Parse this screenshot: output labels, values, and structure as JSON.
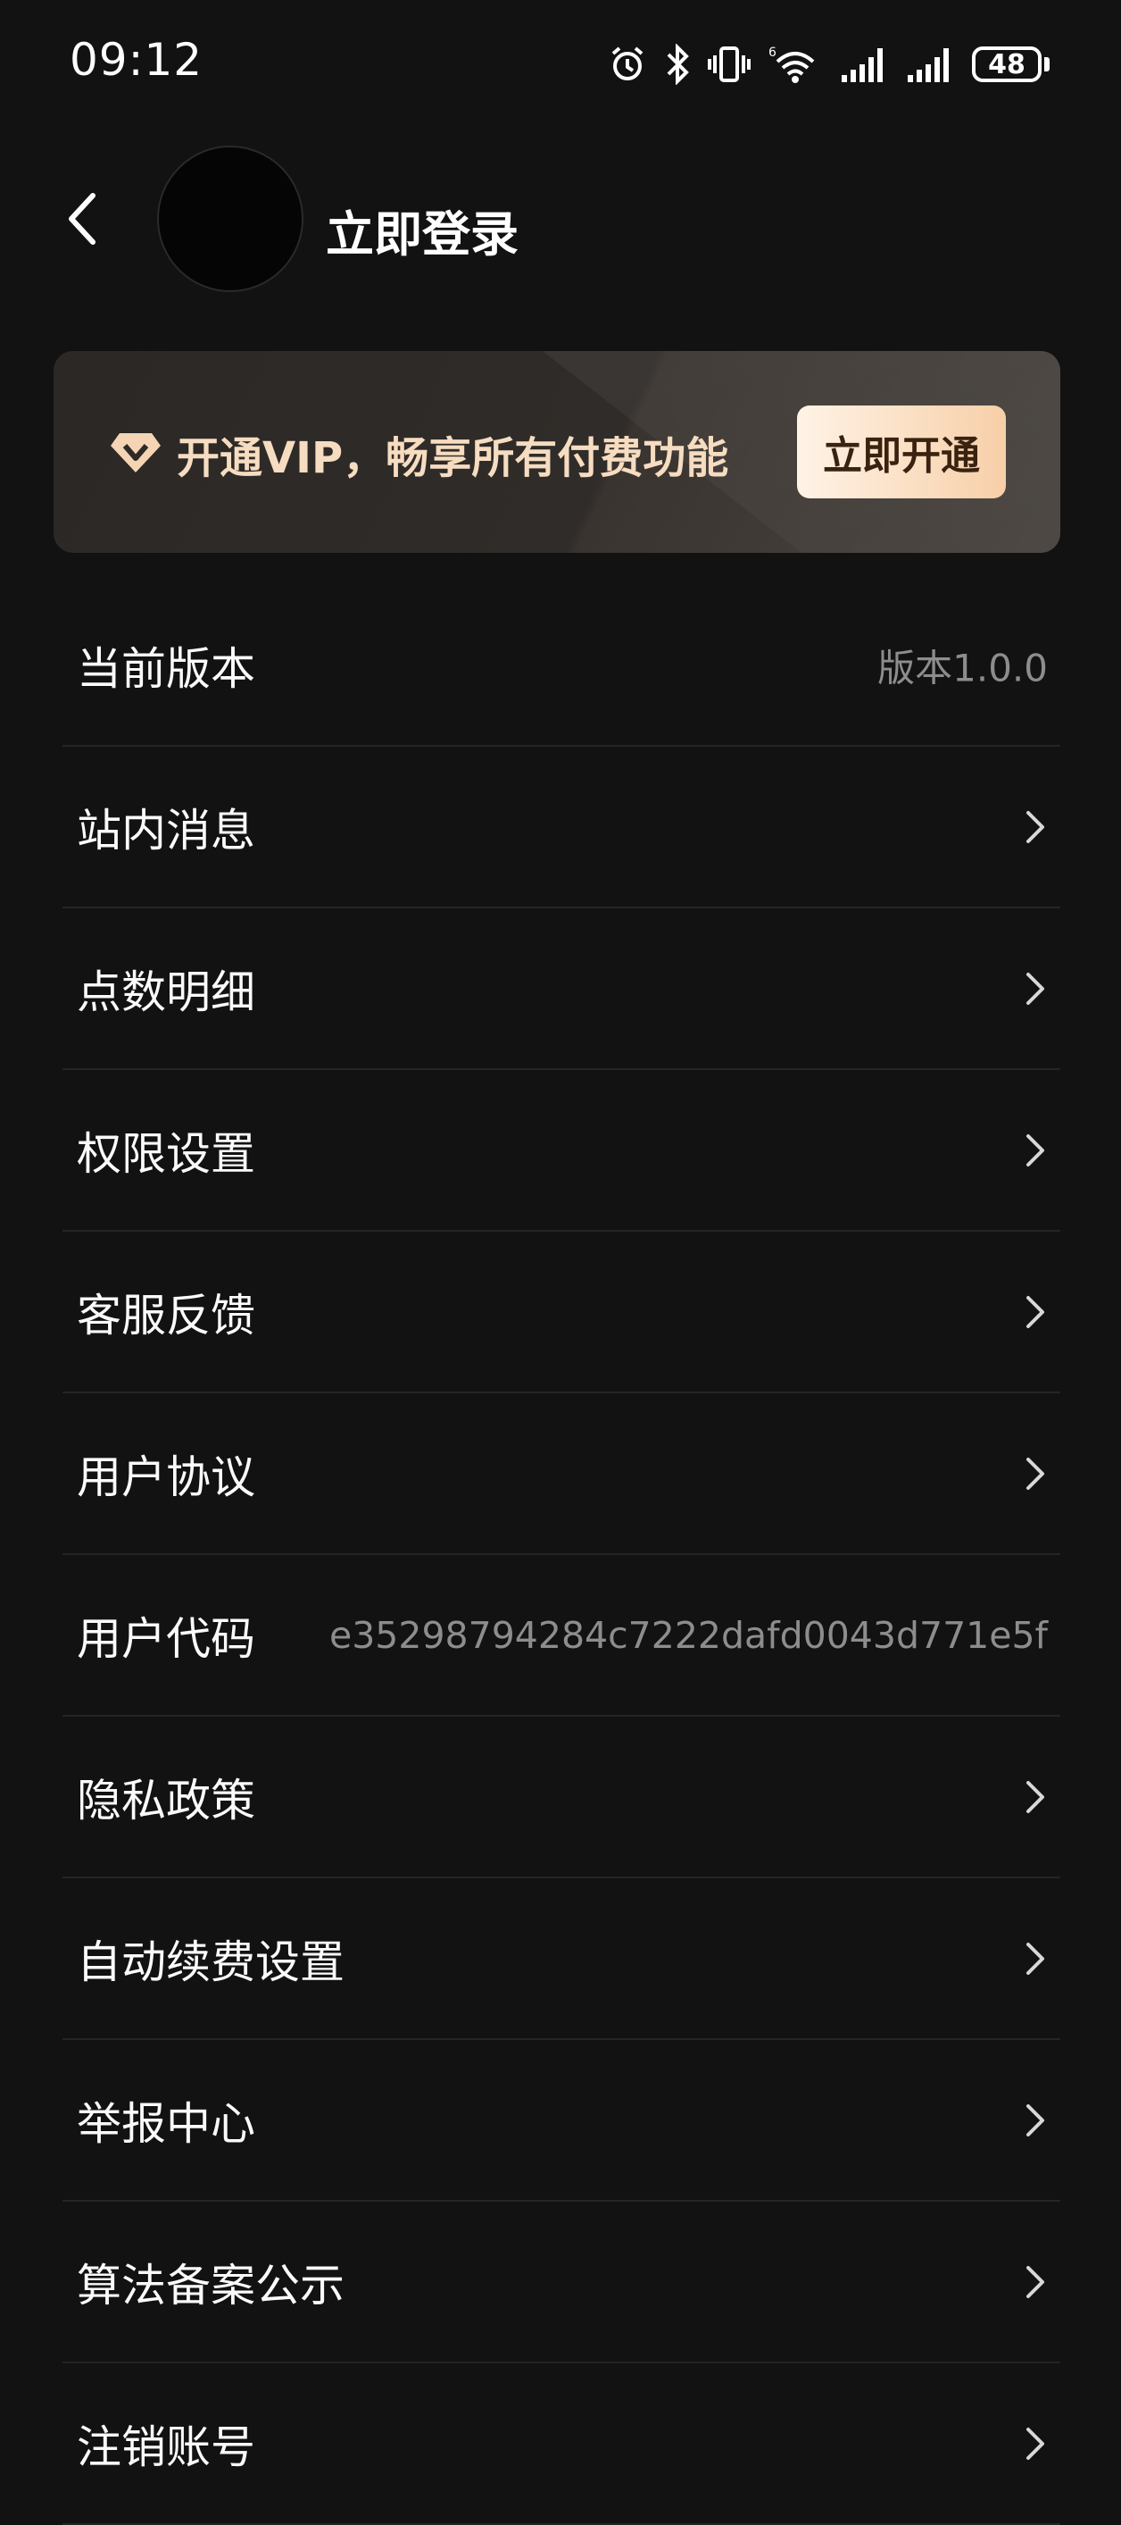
{
  "status_bar": {
    "time": "09:12",
    "battery": "48",
    "icons": [
      "alarm-icon",
      "bluetooth-icon",
      "vibrate-icon",
      "wifi-icon",
      "signal-icon",
      "signal-icon",
      "battery-icon"
    ]
  },
  "header": {
    "login_label": "立即登录"
  },
  "vip_banner": {
    "text": "开通VIP，畅享所有付费功能",
    "button_label": "立即开通",
    "text_color": "#f6dcc0"
  },
  "menu": {
    "items": [
      {
        "label": "当前版本",
        "value": "版本1.0.0",
        "has_arrow": false
      },
      {
        "label": "站内消息",
        "has_arrow": true
      },
      {
        "label": "点数明细",
        "has_arrow": true
      },
      {
        "label": "权限设置",
        "has_arrow": true
      },
      {
        "label": "客服反馈",
        "has_arrow": true
      },
      {
        "label": "用户协议",
        "has_arrow": true
      },
      {
        "label": "用户代码",
        "value": "e35298794284c7222dafd0043d771e5f",
        "has_arrow": false
      },
      {
        "label": "隐私政策",
        "has_arrow": true
      },
      {
        "label": "自动续费设置",
        "has_arrow": true
      },
      {
        "label": "举报中心",
        "has_arrow": true
      },
      {
        "label": "算法备案公示",
        "has_arrow": true
      },
      {
        "label": "注销账号",
        "has_arrow": true
      }
    ]
  }
}
